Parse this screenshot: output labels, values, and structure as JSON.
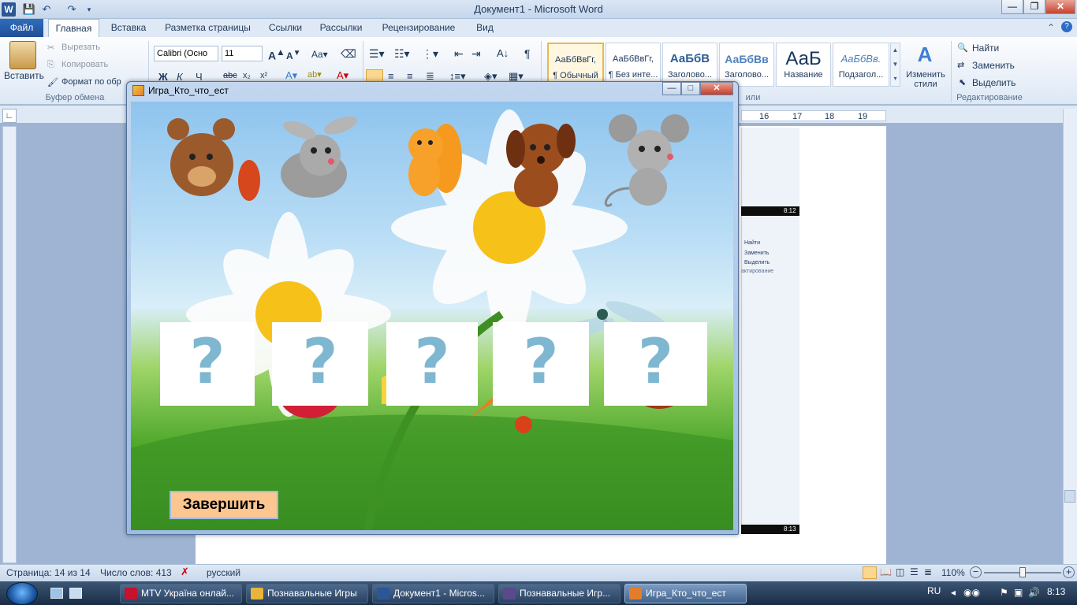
{
  "window": {
    "title": "Документ1  -  Microsoft Word",
    "word_logo": "W",
    "controls": {
      "minimize": "—",
      "maximize": "❐",
      "close": "✕"
    }
  },
  "ribbon_tabs": {
    "file": "Файл",
    "tabs": [
      "Главная",
      "Вставка",
      "Разметка страницы",
      "Ссылки",
      "Рассылки",
      "Рецензирование",
      "Вид"
    ]
  },
  "ribbon": {
    "clipboard": {
      "paste": "Вставить",
      "cut": "Вырезать",
      "copy": "Копировать",
      "format_painter": "Формат по обр",
      "group_label": "Буфер обмена"
    },
    "font": {
      "name": "Calibri (Осно",
      "size": "11"
    },
    "styles": [
      {
        "sample": "АаБбВвГг,",
        "name": "¶ Обычный"
      },
      {
        "sample": "АаБбВвГг,",
        "name": "¶ Без инте..."
      },
      {
        "sample": "АаБбВ",
        "name": "Заголово..."
      },
      {
        "sample": "АаБбВв",
        "name": "Заголово..."
      },
      {
        "sample": "АаБ",
        "name": "Название"
      },
      {
        "sample": "АаБбВв.",
        "name": "Подзагол..."
      }
    ],
    "change_styles": "Изменить стили",
    "styles_group_label": "или",
    "editing": {
      "find": "Найти",
      "replace": "Заменить",
      "select": "Выделить",
      "group_label": "Редактирование"
    }
  },
  "ruler_marks": [
    "16",
    "17",
    "18",
    "19"
  ],
  "game_window": {
    "title": "Игра_Кто_что_ест",
    "controls": {
      "minimize": "—",
      "maximize": "□",
      "close": "✕"
    },
    "animals": [
      "bear",
      "rabbit",
      "squirrel",
      "puppy",
      "mouse"
    ],
    "question_slots": [
      "?",
      "?",
      "?",
      "?",
      "?"
    ],
    "foods": [
      "ham",
      "raspberry",
      "cheese",
      "carrot",
      "dragonfly",
      "hazelnut"
    ],
    "finish_button": "Завершить"
  },
  "status": {
    "page": "Страница: 14 из 14",
    "words": "Число слов: 413",
    "language": "русский",
    "zoom": "110%"
  },
  "taskbar": {
    "tasks": [
      {
        "label": "MTV Україна онлай...",
        "color": "#c4122f"
      },
      {
        "label": "Познавальные Игры",
        "color": "#e8b43a"
      },
      {
        "label": "Документ1 - Micros...",
        "color": "#2b5797"
      },
      {
        "label": "Познавальные Игр...",
        "color": "#5a4a8c"
      },
      {
        "label": "Игра_Кто_что_ест",
        "color": "#e27d2c"
      }
    ],
    "lang": "RU",
    "time": "8:13"
  },
  "embedded_times": [
    "8:12",
    "8:13"
  ],
  "embedded_menu": [
    "Найти",
    "Заменить",
    "Выделить"
  ],
  "embedded_group": "актирование"
}
